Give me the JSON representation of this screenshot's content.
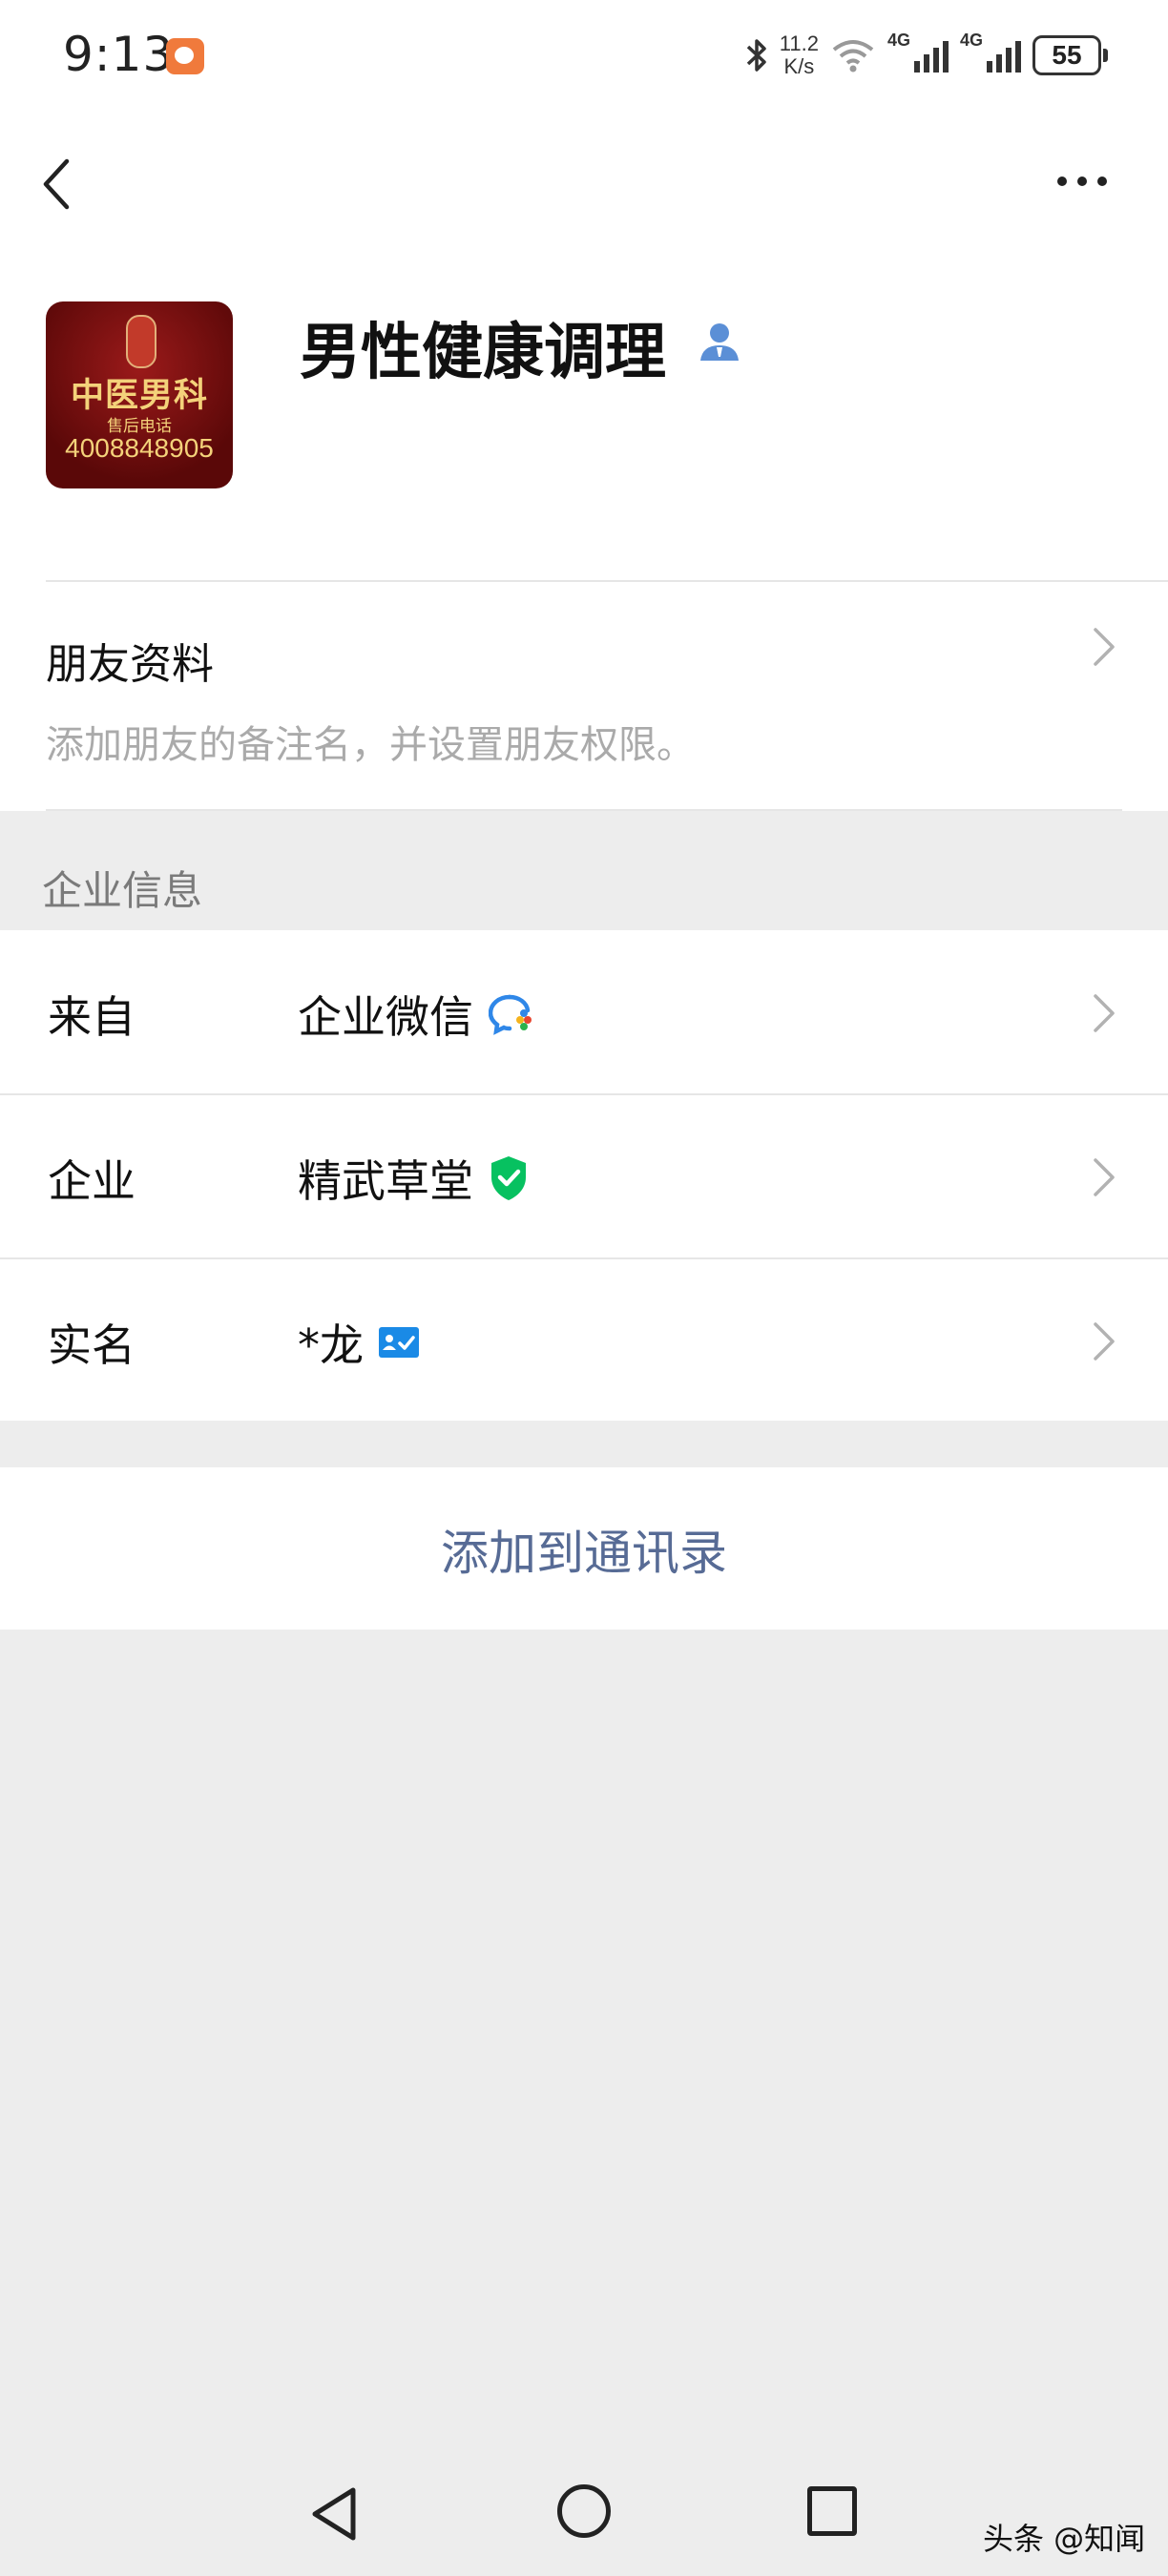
{
  "status_bar": {
    "time": "9:13",
    "speed_value": "11.2",
    "speed_unit": "K/s",
    "network_1": "4G",
    "network_2": "4G",
    "battery": "55",
    "icons": [
      "app-notification-icon",
      "bluetooth-icon",
      "wifi-icon",
      "signal-icon",
      "battery-icon"
    ]
  },
  "header": {
    "back_icon": "chevron-left-icon",
    "more_icon": "more-dots-icon"
  },
  "profile": {
    "avatar": {
      "title": "中医男科",
      "subtitle": "售后电话",
      "phone": "4008848905"
    },
    "name": "男性健康调理",
    "badge_icon": "person-icon"
  },
  "friend_info": {
    "title": "朋友资料",
    "subtitle": "添加朋友的备注名，并设置朋友权限。"
  },
  "enterprise_section": {
    "label": "企业信息",
    "rows": [
      {
        "label": "来自",
        "value": "企业微信",
        "icon": "wecom-icon"
      },
      {
        "label": "企业",
        "value": "精武草堂",
        "icon": "verified-shield-icon"
      },
      {
        "label": "实名",
        "value": "*龙",
        "icon": "id-card-icon"
      }
    ]
  },
  "action": {
    "add_label": "添加到通讯录"
  },
  "nav_bar": {
    "icons": [
      "back-triangle-icon",
      "home-circle-icon",
      "recent-square-icon"
    ]
  },
  "watermark": "头条 @知闻",
  "colors": {
    "link": "#576b95",
    "background": "#ededed",
    "verified_green": "#07c160",
    "id_blue": "#1a8ae6",
    "avatar_red": "#7a0f0f"
  }
}
